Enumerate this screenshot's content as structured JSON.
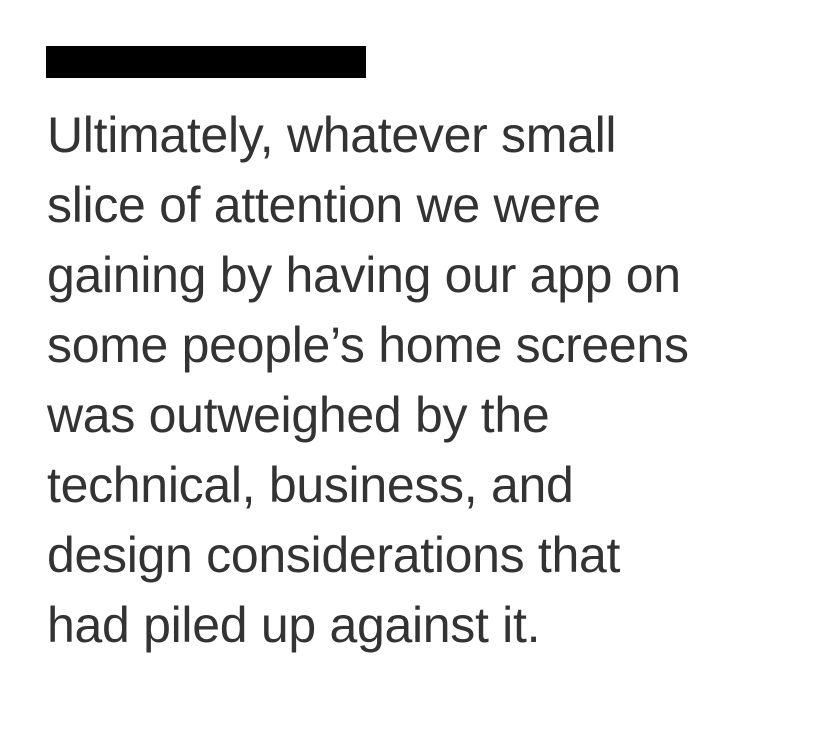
{
  "colors": {
    "background": "#ffffff",
    "redaction": "#000000",
    "text": "#333333"
  },
  "quote": {
    "lines": [
      "Ultimately, whatever small",
      "slice of attention we were",
      "gaining by having our app on",
      "some people’s home screens",
      "was outweighed by the",
      "technical, business, and",
      "design considerations that",
      "had piled up against it."
    ]
  }
}
